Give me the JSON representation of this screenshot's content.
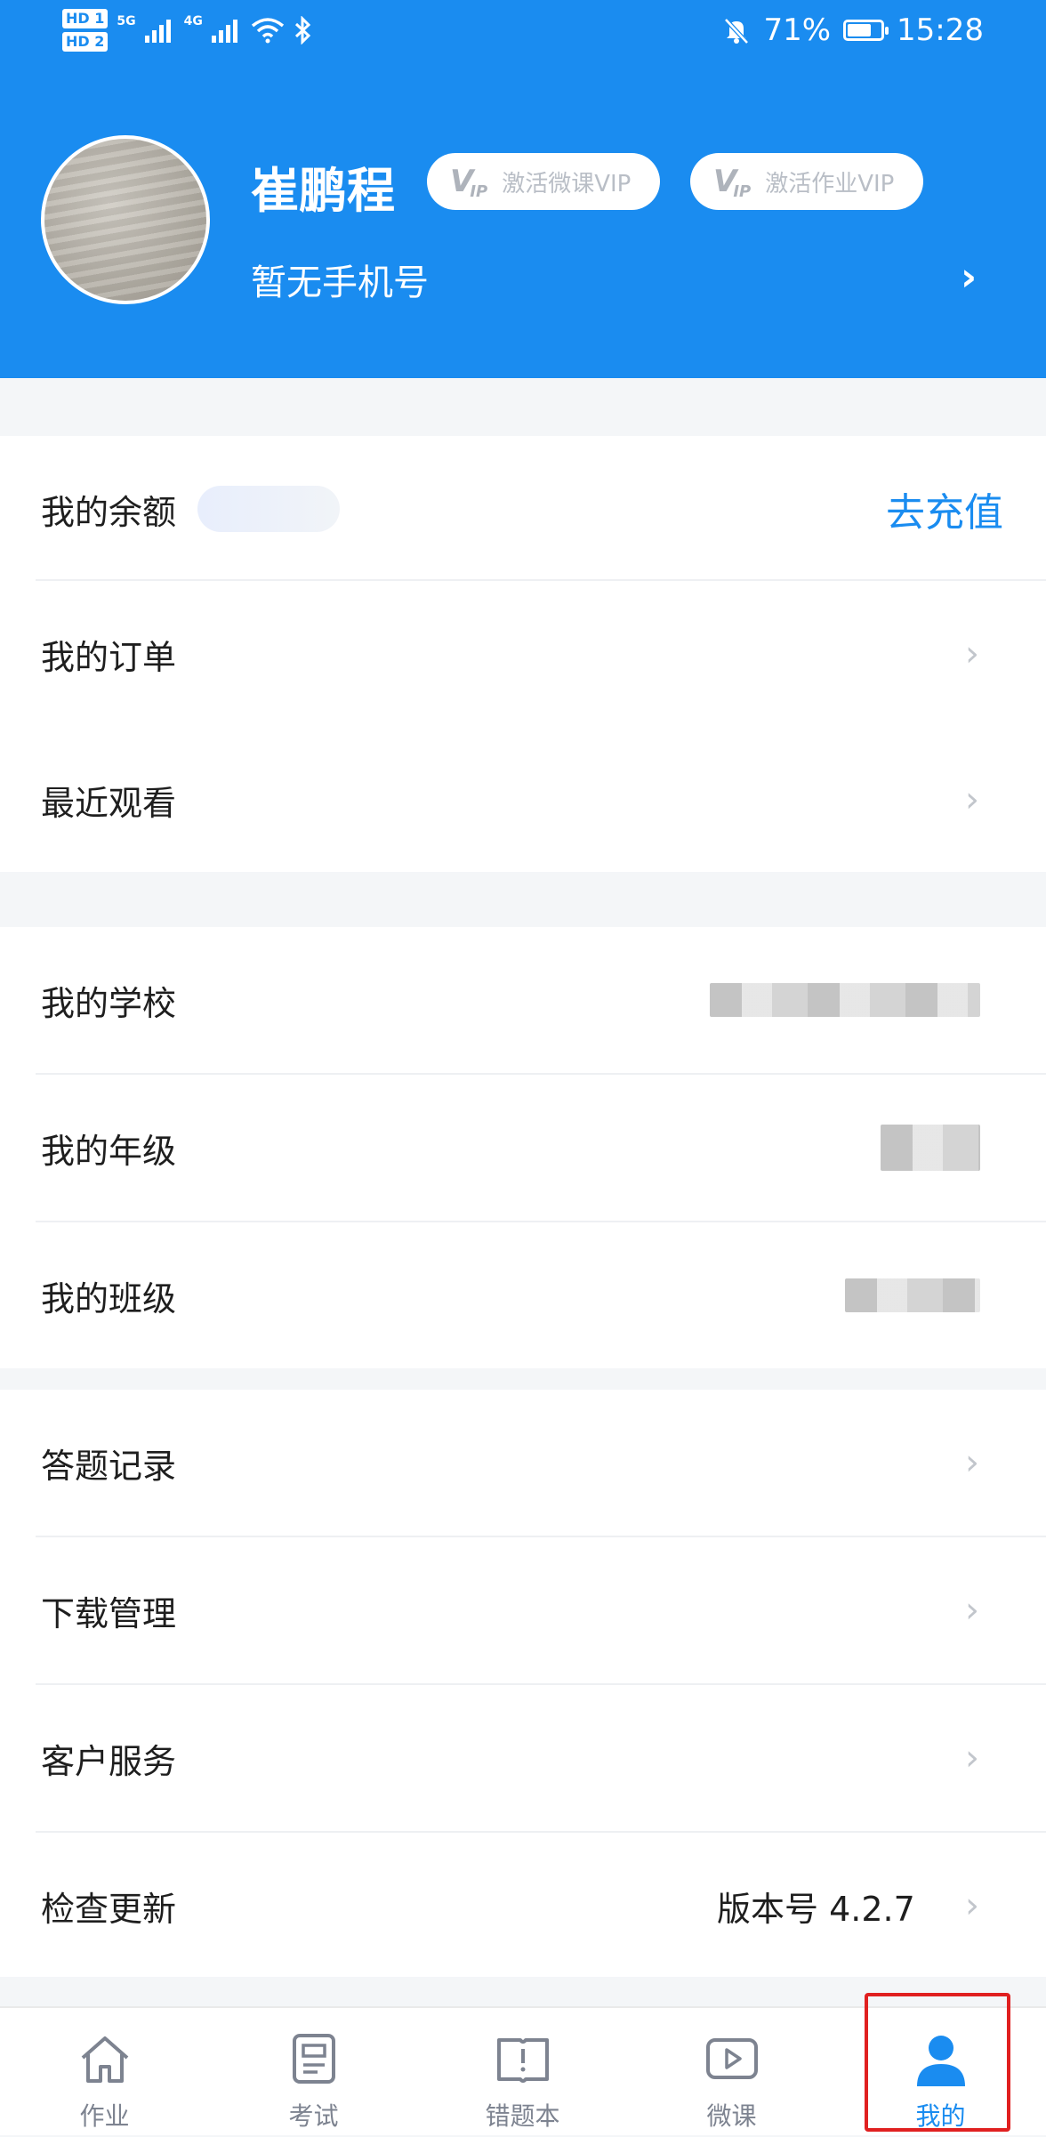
{
  "status_bar": {
    "hd1": "HD 1",
    "hd2": "HD 2",
    "net1": "5G",
    "net2": "4G",
    "battery": "71%",
    "battery_level": 0.71,
    "time": "15:28"
  },
  "profile": {
    "name": "崔鹏程",
    "phone": "暂无手机号",
    "vip_logo": "V",
    "vip_logo_sub": "IP",
    "vip_badges": [
      "激活微课VIP",
      "激活作业VIP"
    ]
  },
  "section1": {
    "balance_label": "我的余额",
    "recharge_label": "去充值",
    "orders_label": "我的订单",
    "recent_label": "最近观看"
  },
  "section2": {
    "school_label": "我的学校",
    "grade_label": "我的年级",
    "class_label": "我的班级"
  },
  "section3": {
    "records_label": "答题记录",
    "downloads_label": "下载管理",
    "service_label": "客户服务",
    "update_label": "检查更新",
    "version_text": "版本号 4.2.7"
  },
  "chevron": "›",
  "bottom_nav": [
    {
      "label": "作业",
      "icon": "home-icon"
    },
    {
      "label": "考试",
      "icon": "exam-icon"
    },
    {
      "label": "错题本",
      "icon": "mistake-book-icon"
    },
    {
      "label": "微课",
      "icon": "video-icon"
    },
    {
      "label": "我的",
      "icon": "person-icon",
      "active": true
    }
  ],
  "colors": {
    "primary": "#1a8cf0",
    "highlight": "#e02020"
  }
}
